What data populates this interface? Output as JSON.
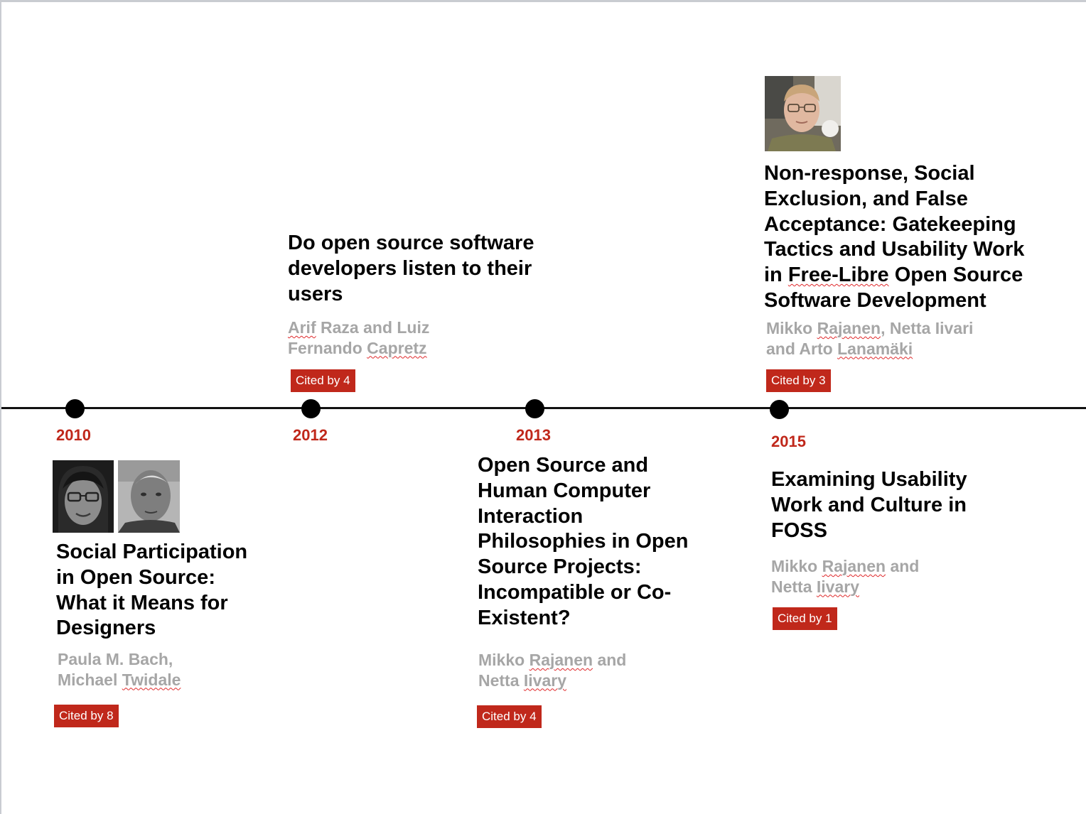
{
  "timeline": {
    "entries": [
      {
        "year": "2010",
        "title_lines": [
          "Social Participation",
          "in Open Source:",
          "What it Means for",
          "Designers"
        ],
        "authors_a": "Paula M. Bach,",
        "authors_b": "Michael ",
        "authors_b_marked": "Twidale",
        "citation": "Cited by 8"
      },
      {
        "year": "2012",
        "title_lines": [
          "Do open source software",
          "developers listen to their",
          "users"
        ],
        "authors_a_marked": "Arif",
        "authors_a": " Raza and Luiz",
        "authors_b": "Fernando ",
        "authors_b_marked": "Capretz",
        "citation": "Cited by 4"
      },
      {
        "year": "2013",
        "title_lines": [
          "Open Source and",
          "Human Computer",
          "Interaction",
          "Philosophies in Open",
          "Source Projects:",
          "Incompatible or Co-",
          "Existent?"
        ],
        "authors_a": "Mikko ",
        "authors_a_marked": "Rajanen",
        "authors_a_tail": " and",
        "authors_b": "Netta ",
        "authors_b_marked": "Iivary",
        "citation": "Cited by 4"
      },
      {
        "year": "2015",
        "title_lines": [
          "Examining Usability",
          "Work and Culture in",
          "FOSS"
        ],
        "authors_a": "Mikko ",
        "authors_a_marked": "Rajanen",
        "authors_a_tail": " and",
        "authors_b": "Netta ",
        "authors_b_marked": "Iivary",
        "citation": "Cited by 1"
      },
      {
        "title_lines_a": [
          "Non-response, Social",
          "Exclusion, and False",
          "Acceptance: Gatekeeping",
          "Tactics and Usability Work"
        ],
        "title_line5_pre": "in ",
        "title_line5_marked": "Free-Libre",
        "title_line5_post": " Open Source",
        "title_line6": "Software Development",
        "authors_a": "Mikko ",
        "authors_a_marked": "Rajanen",
        "authors_a_tail": ", Netta Iivari",
        "authors_b": "and Arto ",
        "authors_b_marked": "Lanamäki",
        "citation": "Cited by 3"
      }
    ]
  },
  "photos": {
    "author_1": "woman-with-glasses-portrait",
    "author_2": "bald-man-portrait",
    "author_3": "young-man-with-glasses-portrait"
  }
}
